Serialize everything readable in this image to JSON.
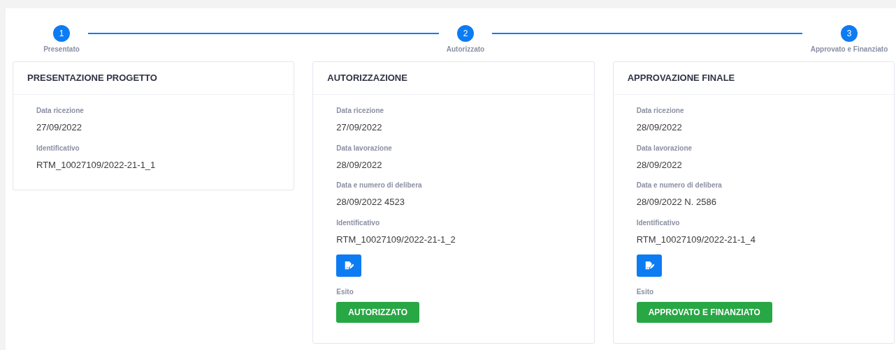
{
  "steps": [
    {
      "number": "1",
      "label": "Presentato",
      "completed": true
    },
    {
      "number": "2",
      "label": "Autorizzato",
      "completed": true
    },
    {
      "number": "3",
      "label": "Approvato e Finanziato",
      "completed": true
    }
  ],
  "cards": [
    {
      "title": "PRESENTAZIONE PROGETTO",
      "fields": [
        {
          "label": "Data ricezione",
          "value": "27/09/2022"
        },
        {
          "label": "Identificativo",
          "value": "RTM_10027109/2022-21-1_1"
        }
      ]
    },
    {
      "title": "AUTORIZZAZIONE",
      "fields": [
        {
          "label": "Data ricezione",
          "value": "27/09/2022"
        },
        {
          "label": "Data lavorazione",
          "value": "28/09/2022"
        },
        {
          "label": "Data e numero di delibera",
          "value": "28/09/2022 4523"
        },
        {
          "label": "Identificativo",
          "value": "RTM_10027109/2022-21-1_2"
        }
      ],
      "edit_button": true,
      "outcome": {
        "label": "Esito",
        "value": "AUTORIZZATO"
      }
    },
    {
      "title": "APPROVAZIONE FINALE",
      "fields": [
        {
          "label": "Data ricezione",
          "value": "28/09/2022"
        },
        {
          "label": "Data lavorazione",
          "value": "28/09/2022"
        },
        {
          "label": "Data e numero di delibera",
          "value": "28/09/2022 N. 2586"
        },
        {
          "label": "Identificativo",
          "value": "RTM_10027109/2022-21-1_4"
        }
      ],
      "edit_button": true,
      "outcome": {
        "label": "Esito",
        "value": "APPROVATO E FINANZIATO"
      }
    }
  ]
}
